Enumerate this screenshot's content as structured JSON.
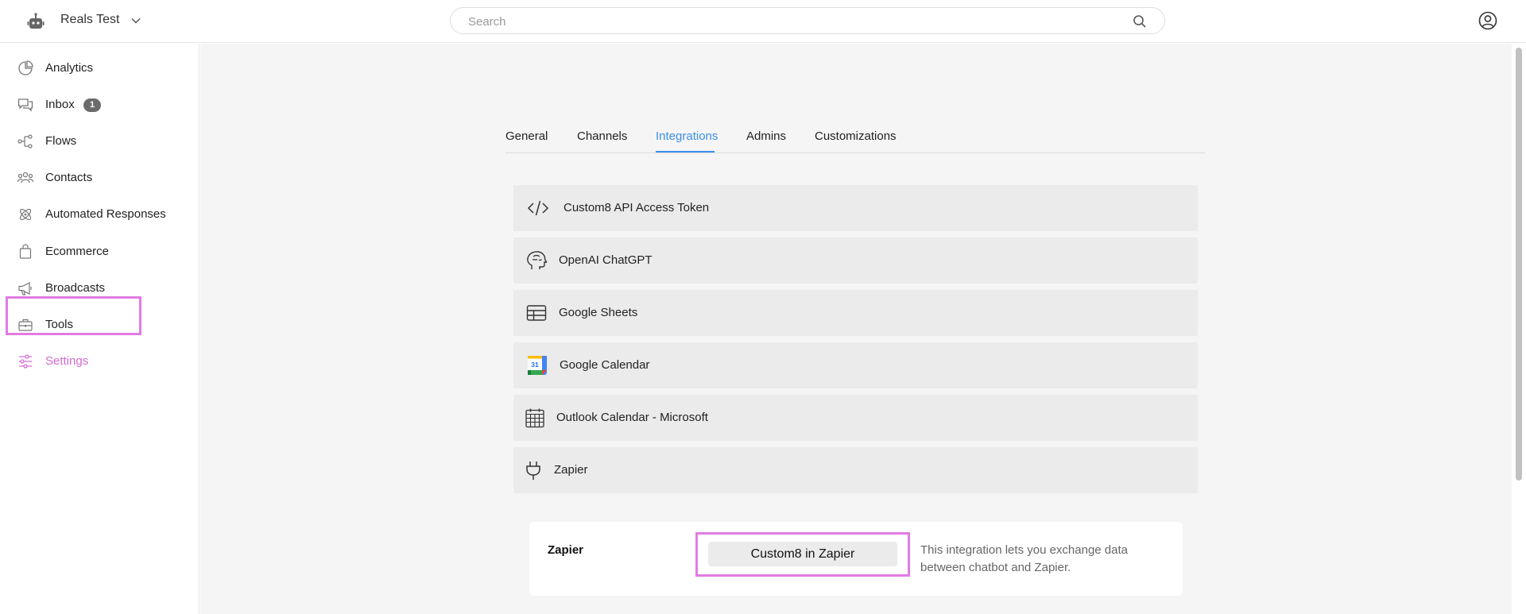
{
  "header": {
    "workspace_name": "Reals Test",
    "search_placeholder": "Search",
    "search_value": ""
  },
  "sidebar": {
    "items": [
      {
        "label": "Analytics",
        "icon": "analytics-icon"
      },
      {
        "label": "Inbox",
        "icon": "inbox-icon",
        "badge": "1"
      },
      {
        "label": "Flows",
        "icon": "flows-icon"
      },
      {
        "label": "Contacts",
        "icon": "contacts-icon"
      },
      {
        "label": "Automated Responses",
        "icon": "automated-responses-icon"
      },
      {
        "label": "Ecommerce",
        "icon": "ecommerce-icon"
      },
      {
        "label": "Broadcasts",
        "icon": "broadcasts-icon"
      },
      {
        "label": "Tools",
        "icon": "tools-icon"
      },
      {
        "label": "Settings",
        "icon": "settings-icon",
        "active": true
      }
    ]
  },
  "tabs": [
    {
      "label": "General"
    },
    {
      "label": "Channels"
    },
    {
      "label": "Integrations",
      "active": true
    },
    {
      "label": "Admins"
    },
    {
      "label": "Customizations"
    }
  ],
  "integrations": [
    {
      "label": "Custom8 API Access Token",
      "icon": "code-icon"
    },
    {
      "label": "OpenAI ChatGPT",
      "icon": "brain-head-icon"
    },
    {
      "label": "Google Sheets",
      "icon": "table-icon"
    },
    {
      "label": "Google Calendar",
      "icon": "google-calendar-icon",
      "icon_text": "31"
    },
    {
      "label": "Outlook Calendar - Microsoft",
      "icon": "calendar-grid-icon"
    },
    {
      "label": "Zapier",
      "icon": "plug-icon"
    }
  ],
  "zapier_card": {
    "title": "Zapier",
    "button_label": "Custom8 in Zapier",
    "description": "This integration lets you exchange data between chatbot and Zapier."
  },
  "colors": {
    "accent_blue": "#3b8fe8",
    "highlight_pink": "#e27be3",
    "active_nav_text": "#d36ad5"
  }
}
